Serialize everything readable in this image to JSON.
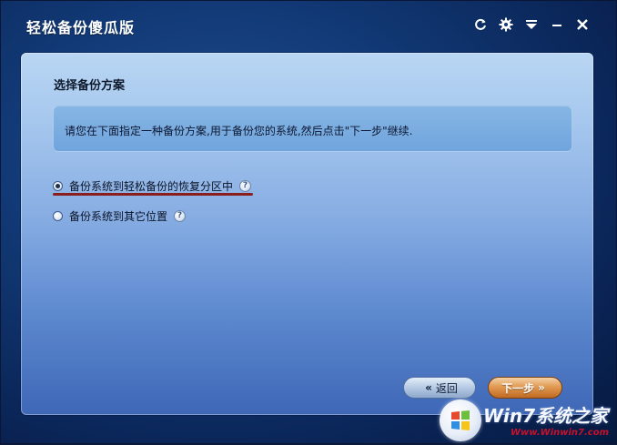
{
  "window": {
    "title": "轻松备份傻瓜版"
  },
  "titlebar_icons": [
    "refresh-icon",
    "gear-icon",
    "dropdown-menu-icon",
    "minimize-icon",
    "close-icon"
  ],
  "panel": {
    "section_title": "选择备份方案",
    "info_text": "请您在下面指定一种备份方案,用于备份您的系统,然后点击\"下一步\"继续.",
    "options": [
      {
        "label": "备份系统到轻松备份的恢复分区中",
        "selected": true
      },
      {
        "label": "备份系统到其它位置",
        "selected": false
      }
    ],
    "help_glyph": "?"
  },
  "buttons": {
    "back": {
      "label": "返回",
      "arrow": "«"
    },
    "next": {
      "label": "下一步",
      "arrow": "»"
    }
  },
  "watermark": {
    "title": "Win7系统之家",
    "url": "Www.Winwin7.com"
  },
  "colors": {
    "accent_underline": "#8c1d1d",
    "next_button": "#e29a52",
    "back_button": "#b5c9e3",
    "window_bg": "#123b78"
  }
}
